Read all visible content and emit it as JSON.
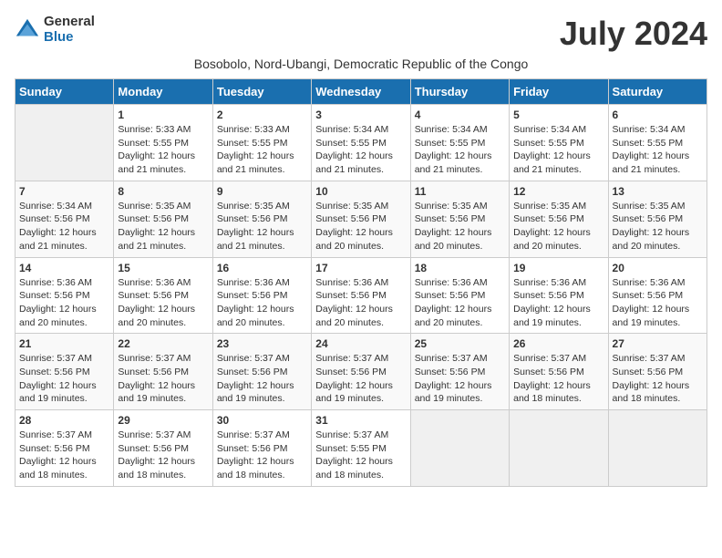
{
  "logo": {
    "general": "General",
    "blue": "Blue"
  },
  "title": "July 2024",
  "subtitle": "Bosobolo, Nord-Ubangi, Democratic Republic of the Congo",
  "days_header": [
    "Sunday",
    "Monday",
    "Tuesday",
    "Wednesday",
    "Thursday",
    "Friday",
    "Saturday"
  ],
  "weeks": [
    [
      {
        "day": "",
        "sunrise": "",
        "sunset": "",
        "daylight": ""
      },
      {
        "day": "1",
        "sunrise": "Sunrise: 5:33 AM",
        "sunset": "Sunset: 5:55 PM",
        "daylight": "Daylight: 12 hours and 21 minutes."
      },
      {
        "day": "2",
        "sunrise": "Sunrise: 5:33 AM",
        "sunset": "Sunset: 5:55 PM",
        "daylight": "Daylight: 12 hours and 21 minutes."
      },
      {
        "day": "3",
        "sunrise": "Sunrise: 5:34 AM",
        "sunset": "Sunset: 5:55 PM",
        "daylight": "Daylight: 12 hours and 21 minutes."
      },
      {
        "day": "4",
        "sunrise": "Sunrise: 5:34 AM",
        "sunset": "Sunset: 5:55 PM",
        "daylight": "Daylight: 12 hours and 21 minutes."
      },
      {
        "day": "5",
        "sunrise": "Sunrise: 5:34 AM",
        "sunset": "Sunset: 5:55 PM",
        "daylight": "Daylight: 12 hours and 21 minutes."
      },
      {
        "day": "6",
        "sunrise": "Sunrise: 5:34 AM",
        "sunset": "Sunset: 5:55 PM",
        "daylight": "Daylight: 12 hours and 21 minutes."
      }
    ],
    [
      {
        "day": "7",
        "sunrise": "Sunrise: 5:34 AM",
        "sunset": "Sunset: 5:56 PM",
        "daylight": "Daylight: 12 hours and 21 minutes."
      },
      {
        "day": "8",
        "sunrise": "Sunrise: 5:35 AM",
        "sunset": "Sunset: 5:56 PM",
        "daylight": "Daylight: 12 hours and 21 minutes."
      },
      {
        "day": "9",
        "sunrise": "Sunrise: 5:35 AM",
        "sunset": "Sunset: 5:56 PM",
        "daylight": "Daylight: 12 hours and 21 minutes."
      },
      {
        "day": "10",
        "sunrise": "Sunrise: 5:35 AM",
        "sunset": "Sunset: 5:56 PM",
        "daylight": "Daylight: 12 hours and 20 minutes."
      },
      {
        "day": "11",
        "sunrise": "Sunrise: 5:35 AM",
        "sunset": "Sunset: 5:56 PM",
        "daylight": "Daylight: 12 hours and 20 minutes."
      },
      {
        "day": "12",
        "sunrise": "Sunrise: 5:35 AM",
        "sunset": "Sunset: 5:56 PM",
        "daylight": "Daylight: 12 hours and 20 minutes."
      },
      {
        "day": "13",
        "sunrise": "Sunrise: 5:35 AM",
        "sunset": "Sunset: 5:56 PM",
        "daylight": "Daylight: 12 hours and 20 minutes."
      }
    ],
    [
      {
        "day": "14",
        "sunrise": "Sunrise: 5:36 AM",
        "sunset": "Sunset: 5:56 PM",
        "daylight": "Daylight: 12 hours and 20 minutes."
      },
      {
        "day": "15",
        "sunrise": "Sunrise: 5:36 AM",
        "sunset": "Sunset: 5:56 PM",
        "daylight": "Daylight: 12 hours and 20 minutes."
      },
      {
        "day": "16",
        "sunrise": "Sunrise: 5:36 AM",
        "sunset": "Sunset: 5:56 PM",
        "daylight": "Daylight: 12 hours and 20 minutes."
      },
      {
        "day": "17",
        "sunrise": "Sunrise: 5:36 AM",
        "sunset": "Sunset: 5:56 PM",
        "daylight": "Daylight: 12 hours and 20 minutes."
      },
      {
        "day": "18",
        "sunrise": "Sunrise: 5:36 AM",
        "sunset": "Sunset: 5:56 PM",
        "daylight": "Daylight: 12 hours and 20 minutes."
      },
      {
        "day": "19",
        "sunrise": "Sunrise: 5:36 AM",
        "sunset": "Sunset: 5:56 PM",
        "daylight": "Daylight: 12 hours and 19 minutes."
      },
      {
        "day": "20",
        "sunrise": "Sunrise: 5:36 AM",
        "sunset": "Sunset: 5:56 PM",
        "daylight": "Daylight: 12 hours and 19 minutes."
      }
    ],
    [
      {
        "day": "21",
        "sunrise": "Sunrise: 5:37 AM",
        "sunset": "Sunset: 5:56 PM",
        "daylight": "Daylight: 12 hours and 19 minutes."
      },
      {
        "day": "22",
        "sunrise": "Sunrise: 5:37 AM",
        "sunset": "Sunset: 5:56 PM",
        "daylight": "Daylight: 12 hours and 19 minutes."
      },
      {
        "day": "23",
        "sunrise": "Sunrise: 5:37 AM",
        "sunset": "Sunset: 5:56 PM",
        "daylight": "Daylight: 12 hours and 19 minutes."
      },
      {
        "day": "24",
        "sunrise": "Sunrise: 5:37 AM",
        "sunset": "Sunset: 5:56 PM",
        "daylight": "Daylight: 12 hours and 19 minutes."
      },
      {
        "day": "25",
        "sunrise": "Sunrise: 5:37 AM",
        "sunset": "Sunset: 5:56 PM",
        "daylight": "Daylight: 12 hours and 19 minutes."
      },
      {
        "day": "26",
        "sunrise": "Sunrise: 5:37 AM",
        "sunset": "Sunset: 5:56 PM",
        "daylight": "Daylight: 12 hours and 18 minutes."
      },
      {
        "day": "27",
        "sunrise": "Sunrise: 5:37 AM",
        "sunset": "Sunset: 5:56 PM",
        "daylight": "Daylight: 12 hours and 18 minutes."
      }
    ],
    [
      {
        "day": "28",
        "sunrise": "Sunrise: 5:37 AM",
        "sunset": "Sunset: 5:56 PM",
        "daylight": "Daylight: 12 hours and 18 minutes."
      },
      {
        "day": "29",
        "sunrise": "Sunrise: 5:37 AM",
        "sunset": "Sunset: 5:56 PM",
        "daylight": "Daylight: 12 hours and 18 minutes."
      },
      {
        "day": "30",
        "sunrise": "Sunrise: 5:37 AM",
        "sunset": "Sunset: 5:56 PM",
        "daylight": "Daylight: 12 hours and 18 minutes."
      },
      {
        "day": "31",
        "sunrise": "Sunrise: 5:37 AM",
        "sunset": "Sunset: 5:55 PM",
        "daylight": "Daylight: 12 hours and 18 minutes."
      },
      {
        "day": "",
        "sunrise": "",
        "sunset": "",
        "daylight": ""
      },
      {
        "day": "",
        "sunrise": "",
        "sunset": "",
        "daylight": ""
      },
      {
        "day": "",
        "sunrise": "",
        "sunset": "",
        "daylight": ""
      }
    ]
  ]
}
